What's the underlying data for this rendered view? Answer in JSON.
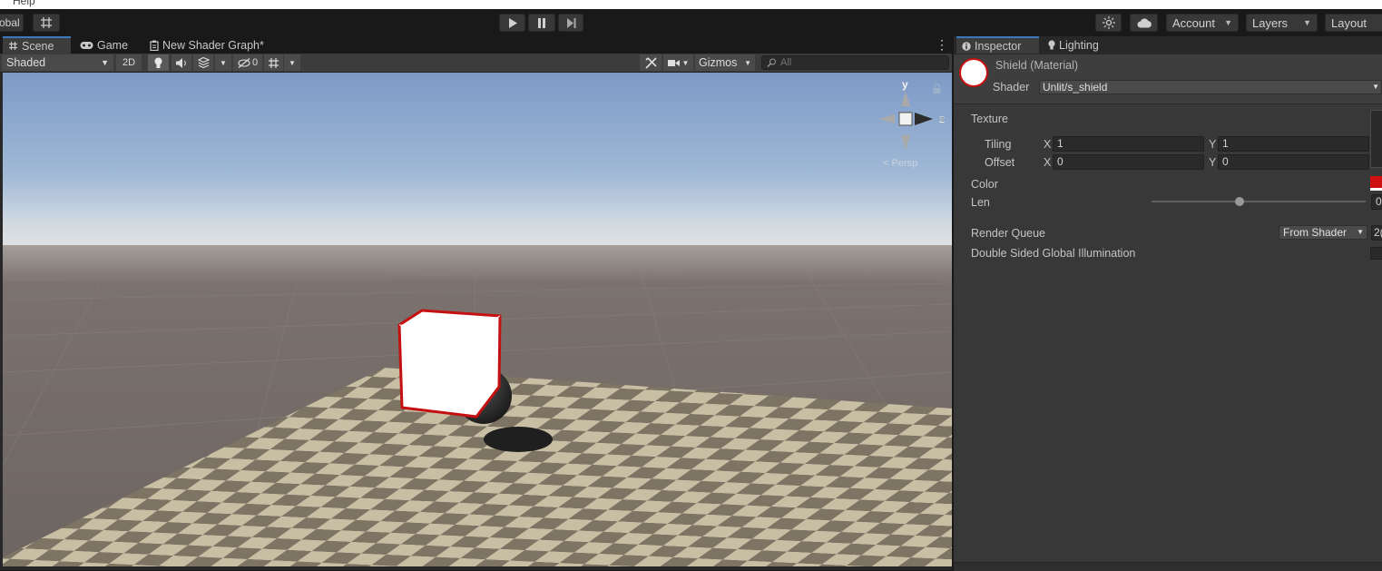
{
  "menu": {
    "help": "Help"
  },
  "toolbar": {
    "global_label": "obal",
    "account_label": "Account",
    "layers_label": "Layers",
    "layout_label": "Layout"
  },
  "scene_tabs": [
    {
      "label": "Scene",
      "icon": "hash-icon"
    },
    {
      "label": "Game",
      "icon": "gamepad-icon"
    },
    {
      "label": "New Shader Graph*",
      "icon": "shader-graph-icon"
    }
  ],
  "scene_toolbar": {
    "draw_mode": "Shaded",
    "mode_2d": "2D",
    "hidden_count": "0",
    "gizmos_label": "Gizmos",
    "search_placeholder": "All"
  },
  "gizmo": {
    "y": "y",
    "z": "z",
    "persp": "Persp"
  },
  "inspector_tabs": [
    {
      "label": "Inspector",
      "icon": "info-icon"
    },
    {
      "label": "Lighting",
      "icon": "lightbulb-icon"
    }
  ],
  "material": {
    "name": "Shield (Material)",
    "shader_label": "Shader",
    "shader_value": "Unlit/s_shield"
  },
  "properties": {
    "texture_label": "Texture",
    "tiling_label": "Tiling",
    "offset_label": "Offset",
    "tiling_x": "1",
    "tiling_y": "1",
    "offset_x": "0",
    "offset_y": "0",
    "x_label": "X",
    "y_label": "Y",
    "color_label": "Color",
    "color_value": "#d01010",
    "len_label": "Len",
    "len_value_fraction": 0.41,
    "len_value_text": "0",
    "render_queue_label": "Render Queue",
    "render_queue_mode": "From Shader",
    "render_queue_value": "2(",
    "dsgi_label": "Double Sided Global Illumination"
  },
  "colors": {
    "accent": "#3a79bb",
    "outline": "#c41010"
  }
}
